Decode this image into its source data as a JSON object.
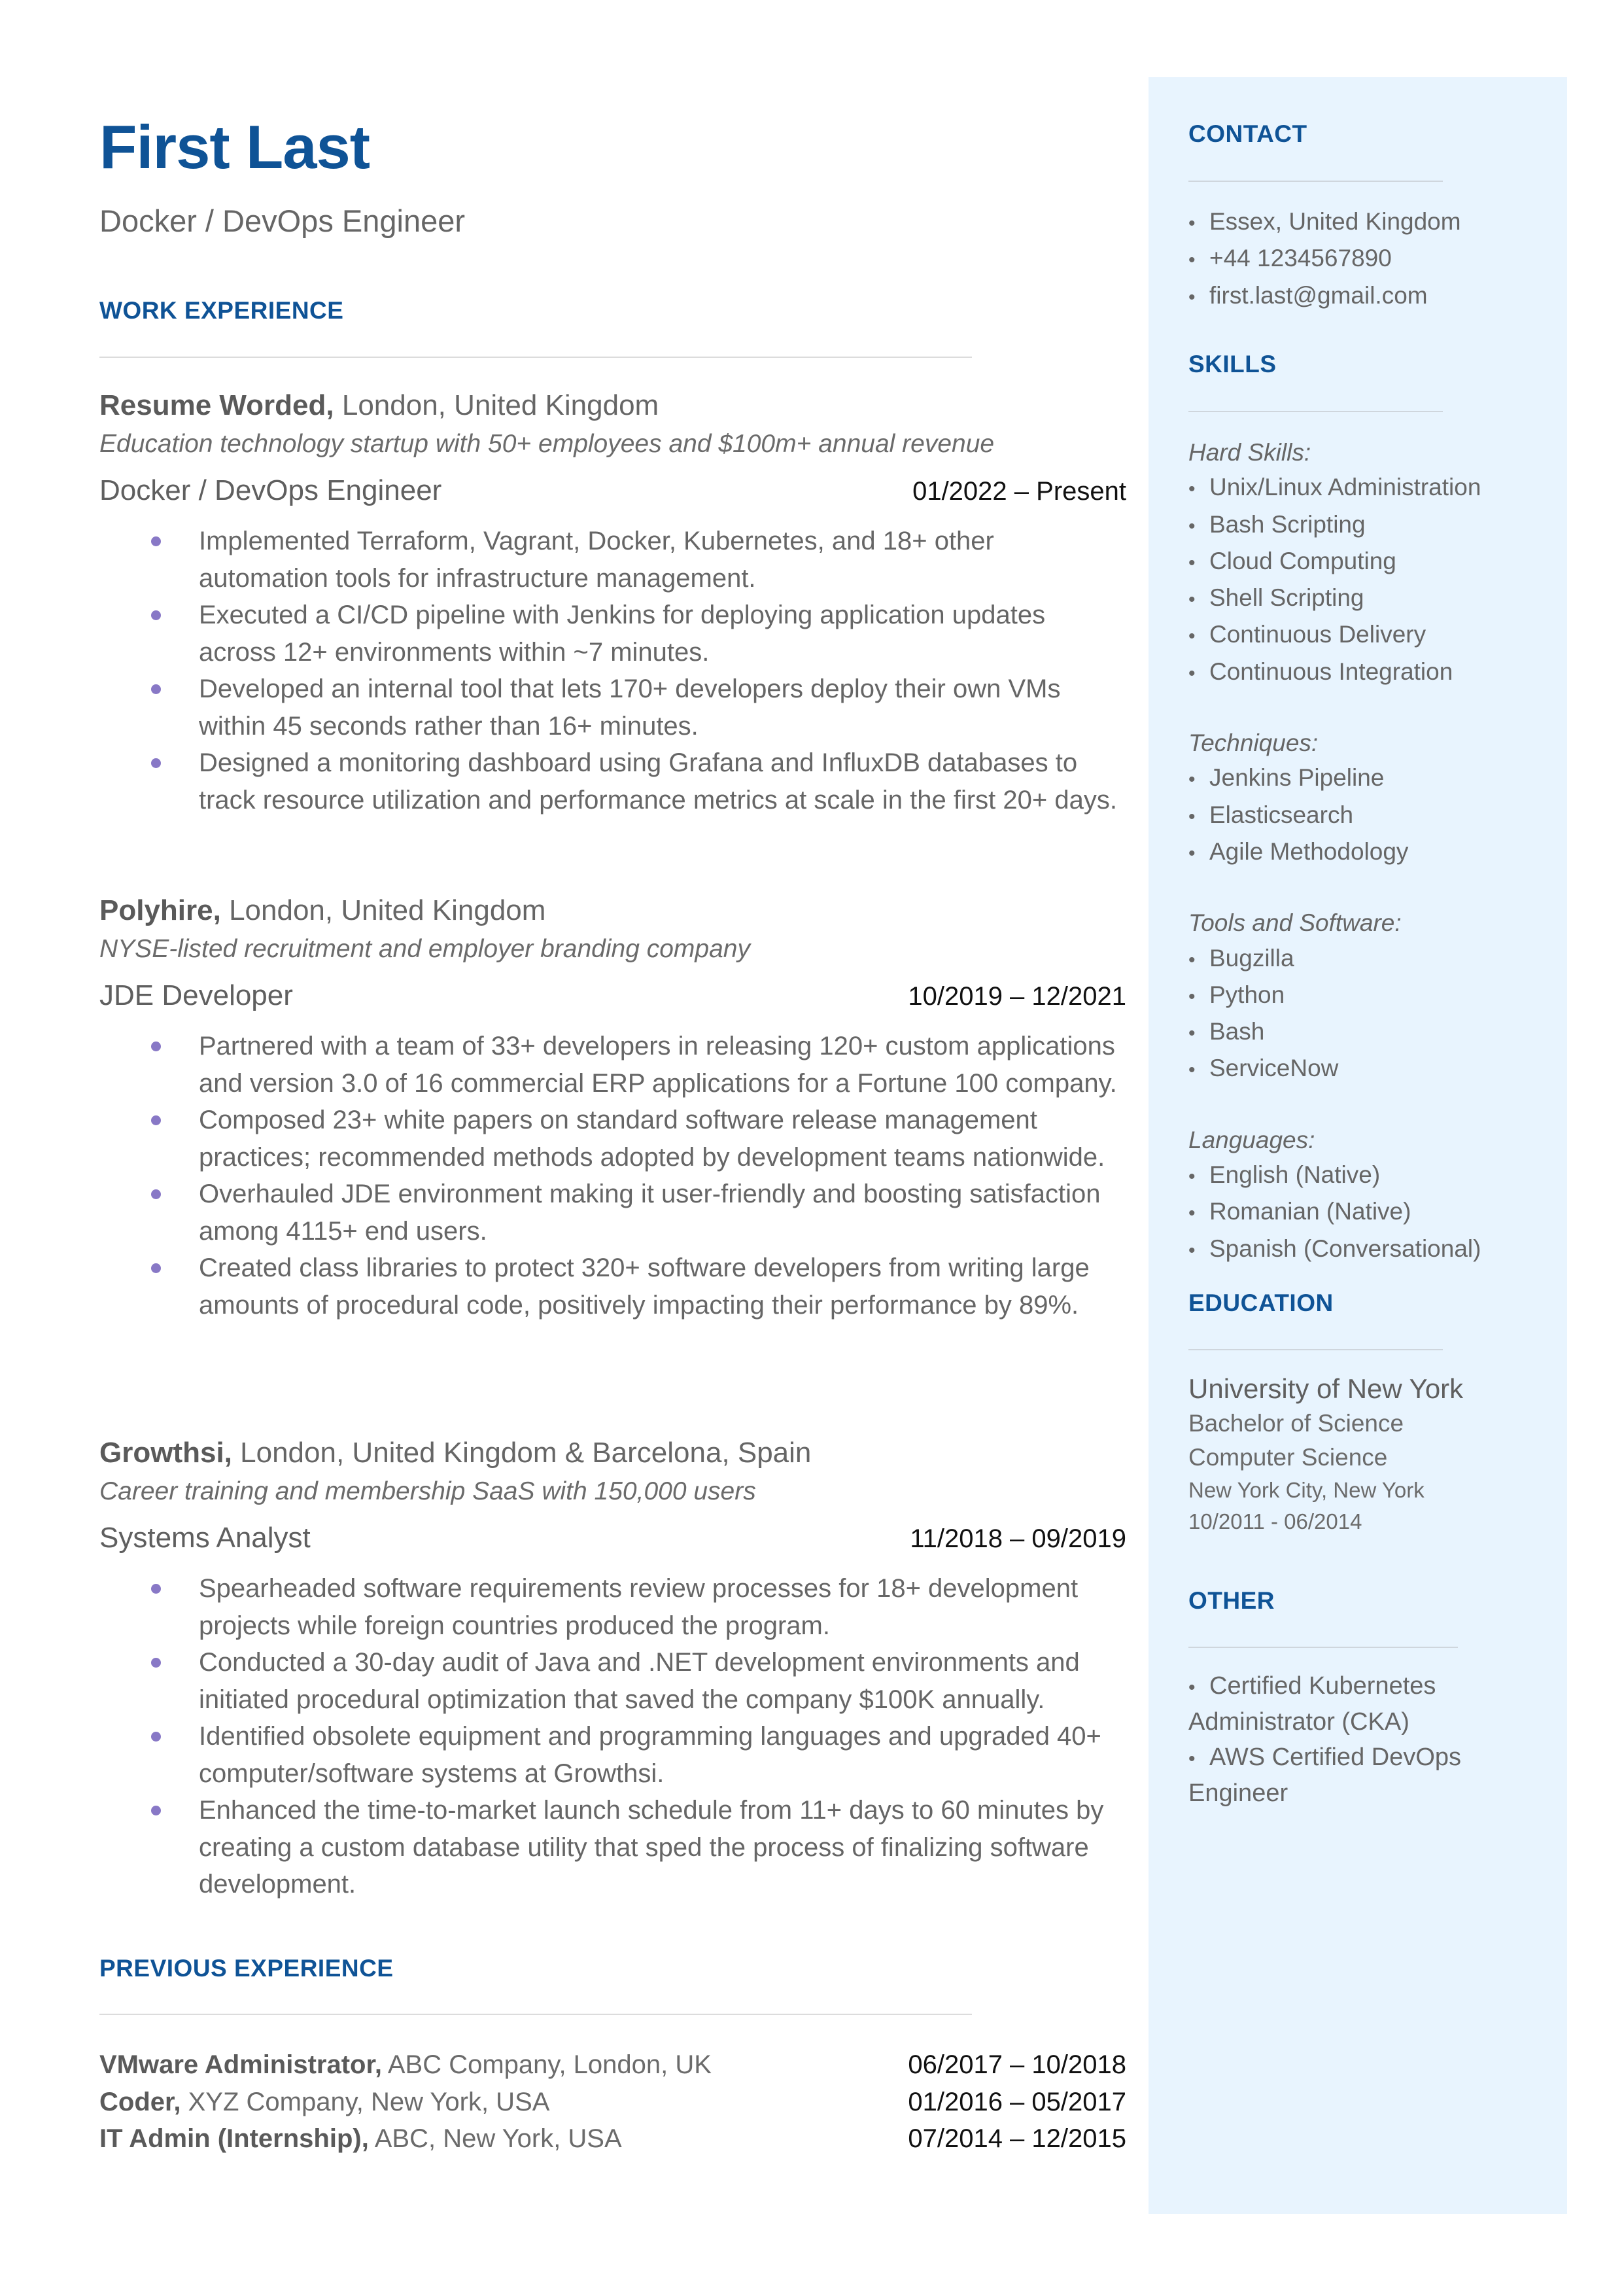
{
  "header": {
    "name": "First Last",
    "title": "Docker / DevOps Engineer"
  },
  "colors": {
    "accent": "#0f5396",
    "bullet": "#8878c6",
    "sidebar_bg": "#e8f4fe",
    "body_text": "#666666"
  },
  "sections": {
    "work_experience": "WORK EXPERIENCE",
    "previous_experience": "PREVIOUS EXPERIENCE",
    "contact": "CONTACT",
    "skills": "SKILLS",
    "education": "EDUCATION",
    "other": "OTHER"
  },
  "work": [
    {
      "company": "Resume Worded,",
      "location": "London, United Kingdom",
      "description": "Education technology startup with 50+ employees and $100m+ annual revenue",
      "role": "Docker / DevOps Engineer",
      "dates": "01/2022 – Present",
      "bullets": [
        "Implemented Terraform, Vagrant, Docker, Kubernetes, and 18+ other automation tools for infrastructure management.",
        "Executed a CI/CD pipeline with Jenkins for deploying application updates across 12+ environments within ~7 minutes.",
        "Developed an internal tool that lets 170+ developers deploy their own VMs within 45 seconds rather than 16+ minutes.",
        "Designed a monitoring dashboard using Grafana and InfluxDB databases to track resource utilization and performance metrics at scale in the first 20+ days."
      ]
    },
    {
      "company": "Polyhire,",
      "location": "London, United Kingdom",
      "description": "NYSE-listed recruitment and employer branding company",
      "role": "JDE Developer",
      "dates": "10/2019 – 12/2021",
      "bullets": [
        "Partnered with a team of 33+ developers in releasing 120+ custom applications and version 3.0 of 16 commercial ERP applications for a Fortune 100 company.",
        "Composed 23+ white papers on standard software release management practices; recommended methods adopted by development teams nationwide.",
        "Overhauled JDE environment making it user-friendly and boosting satisfaction among 4115+ end users.",
        "Created class libraries to protect 320+ software developers from writing large amounts of procedural code, positively impacting their performance by 89%."
      ]
    },
    {
      "company": "Growthsi,",
      "location": "London, United Kingdom & Barcelona, Spain",
      "description": "Career training and membership SaaS with 150,000 users",
      "role": "Systems Analyst",
      "dates": "11/2018 – 09/2019",
      "bullets": [
        "Spearheaded software requirements review processes for 18+ development projects while foreign countries produced the program.",
        "Conducted a 30-day audit of Java and .NET development environments and initiated procedural optimization that saved the company $100K annually.",
        "Identified obsolete equipment and programming languages and upgraded 40+ computer/software systems at Growthsi.",
        "Enhanced the time-to-market launch schedule from 11+ days to 60 minutes by creating a custom database utility that sped the process of finalizing software development."
      ]
    }
  ],
  "previous": [
    {
      "role": "VMware Administrator,",
      "org": "ABC Company, London, UK",
      "dates": "06/2017 – 10/2018"
    },
    {
      "role": "Coder,",
      "org": "XYZ Company, New York, USA",
      "dates": "01/2016 – 05/2017"
    },
    {
      "role": "IT Admin (Internship),",
      "org": "ABC, New York, USA",
      "dates": "07/2014 – 12/2015"
    }
  ],
  "contact": [
    "Essex, United Kingdom",
    "+44 1234567890",
    "first.last@gmail.com"
  ],
  "skills": {
    "hard_label": "Hard Skills:",
    "hard": [
      "Unix/Linux Administration",
      "Bash Scripting",
      "Cloud Computing",
      "Shell Scripting",
      "Continuous Delivery",
      "Continuous Integration"
    ],
    "techniques_label": "Techniques:",
    "techniques": [
      "Jenkins Pipeline",
      "Elasticsearch",
      "Agile Methodology"
    ],
    "tools_label": "Tools and Software:",
    "tools": [
      "Bugzilla",
      "Python",
      "Bash",
      "ServiceNow"
    ],
    "languages_label": "Languages:",
    "languages": [
      "English (Native)",
      "Romanian (Native)",
      "Spanish (Conversational)"
    ]
  },
  "education": {
    "school": "University of New York",
    "degree": "Bachelor of Science",
    "field": "Computer Science",
    "location": "New York City, New York",
    "dates": "10/2011 - 06/2014"
  },
  "other": [
    "Certified Kubernetes Administrator (CKA)",
    "AWS Certified DevOps Engineer"
  ],
  "bullet_glyph": "•"
}
